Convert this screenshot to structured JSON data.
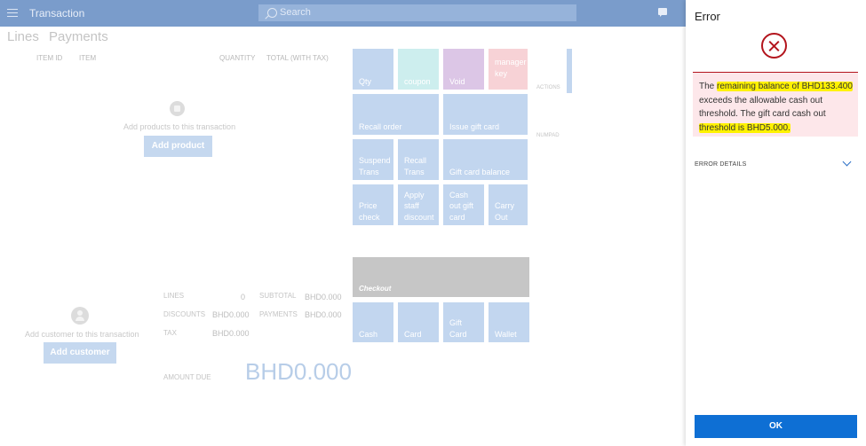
{
  "header": {
    "title": "Transaction",
    "search_placeholder": "Search"
  },
  "tabs": [
    "Lines",
    "Payments"
  ],
  "lines_columns": [
    "ITEM ID",
    "ITEM",
    "QUANTITY",
    "TOTAL (WITH TAX)"
  ],
  "products": {
    "hint": "Add products to this transaction",
    "button": "Add product"
  },
  "customer": {
    "hint": "Add customer to this transaction",
    "button": "Add customer"
  },
  "totals": {
    "lines_label": "LINES",
    "lines_value": "0",
    "discounts_label": "DISCOUNTS",
    "discounts_value": "BHD0.000",
    "tax_label": "TAX",
    "tax_value": "BHD0.000",
    "subtotal_label": "SUBTOTAL",
    "subtotal_value": "BHD0.000",
    "payments_label": "PAYMENTS",
    "payments_value": "BHD0.000",
    "amount_due_label": "AMOUNT DUE",
    "amount_due_value": "BHD0.000"
  },
  "tiles": {
    "qty": "Qty",
    "coupon": "coupon",
    "void": "Void",
    "manager_key": "manager key",
    "recall_order": "Recall order",
    "issue_gift_card": "Issue gift card",
    "suspend_trans": "Suspend Trans",
    "recall_trans": "Recall Trans",
    "gift_card_balance": "Gift card balance",
    "price_check": "Price check",
    "apply_staff_discount": "Apply staff discount",
    "cash_out_gift_card": "Cash out gift card",
    "carry_out": "Carry Out",
    "checkout": "Checkout",
    "cash": "Cash",
    "card": "Card",
    "gift_card": "Gift Card",
    "wallet": "Wallet"
  },
  "side_labels": {
    "actions": "ACTIONS",
    "numpad": "NUMPAD"
  },
  "error_panel": {
    "title": "Error",
    "message_1": "The ",
    "message_hl_1": "remaining balance of BHD133.400",
    "message_2": " exceeds the allowable cash out threshold. The gift card cash out ",
    "message_hl_2": "threshold is BHD5.000.",
    "details_label": "ERROR DETAILS",
    "ok_label": "OK"
  },
  "colors": {
    "error": "#b3151d",
    "primary": "#0e6fd4",
    "highlight": "#fff200"
  },
  "icons": [
    "menu-icon",
    "search-icon",
    "chat-icon",
    "shopping-bag-icon",
    "person-icon",
    "error-icon",
    "chevron-down-icon"
  ]
}
